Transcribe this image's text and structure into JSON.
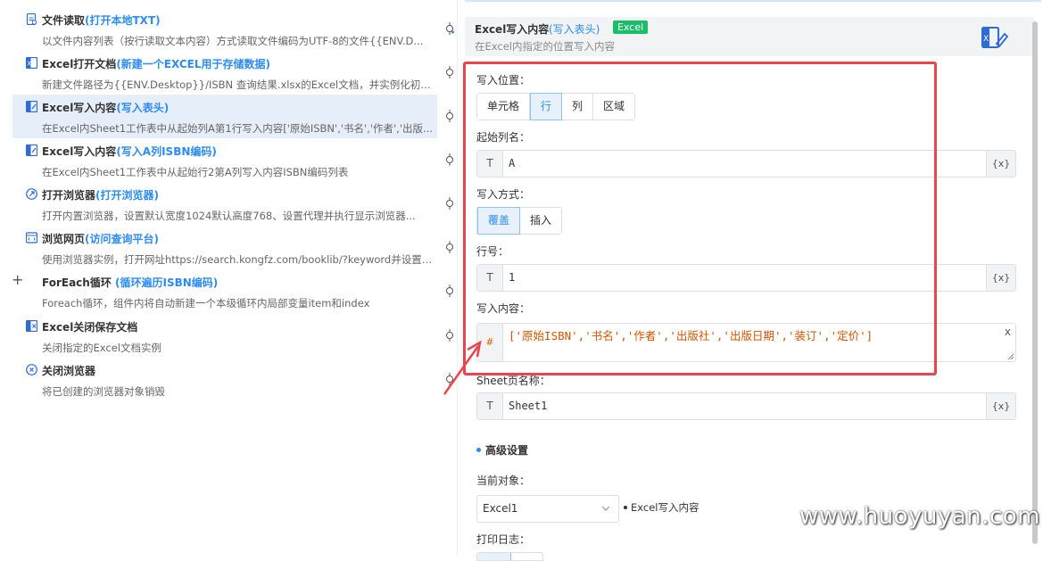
{
  "steps": [
    {
      "title": "文件读取",
      "link": "(打开本地TXT)",
      "desc": "以文件内容列表（按行读取文本内容）方式读取文件编码为UTF-8的文件{{ENV.D...",
      "icon": "file-read-icon"
    },
    {
      "title": "Excel打开文档",
      "link": "(新建一个EXCEL用于存储数据)",
      "desc": "新建文件路径为{{ENV.Desktop}}/ISBN 查询结果.xlsx的Excel文档，并实例化初始...",
      "icon": "excel-open-icon"
    },
    {
      "title": "Excel写入内容",
      "link": "(写入表头)",
      "desc": "在Excel内Sheet1工作表中从起始列A第1行写入内容['原始ISBN','书名','作者','出版...",
      "icon": "excel-write-icon"
    },
    {
      "title": "Excel写入内容",
      "link": "(写入A列ISBN编码)",
      "desc": "在Excel内Sheet1工作表中从起始行2第A列写入内容ISBN编码列表",
      "icon": "excel-write-icon"
    },
    {
      "title": "打开浏览器",
      "link": "(打开浏览器)",
      "desc": "打开内置浏览器，设置默认宽度1024默认高度768、设置代理并执行显示浏览器...",
      "icon": "browser-open-icon"
    },
    {
      "title": "浏览网页",
      "link": "(访问查询平台)",
      "desc": "使用浏览器实例，打开网址https://search.kongfz.com/booklib/?keyword并设置Us...",
      "icon": "browse-web-icon"
    },
    {
      "title": "ForEach循环",
      "link": " (循环遍历ISBN编码)",
      "desc": "Foreach循环，组件内将自动新建一个本级循环内局部变量item和index",
      "icon": "loop-icon"
    },
    {
      "title": "Excel关闭保存文档",
      "link": "",
      "desc": "关闭指定的Excel文档实例",
      "icon": "excel-close-icon"
    },
    {
      "title": "关闭浏览器",
      "link": "",
      "desc": "将已创建的浏览器对象销毁",
      "icon": "browser-close-icon"
    }
  ],
  "header": {
    "title": "Excel写入内容",
    "subtitle": "(写入表头)",
    "badge": "Excel",
    "desc": "在Excel内指定的位置写入内容"
  },
  "form": {
    "write_position_label": "写入位置：",
    "write_position_options": [
      "单元格",
      "行",
      "列",
      "区域"
    ],
    "write_position_selected": "行",
    "start_col_label": "起始列名：",
    "start_col_value": "A",
    "write_mode_label": "写入方式：",
    "write_mode_options": [
      "覆盖",
      "插入"
    ],
    "write_mode_selected": "覆盖",
    "row_label": "行号：",
    "row_value": "1",
    "content_label": "写入内容：",
    "content_value": "['原始ISBN','书名','作者','出版社','出版日期','装订','定价']",
    "sheet_label": "Sheet页名称：",
    "sheet_value": "Sheet1",
    "text_prefix": "T",
    "expr_prefix": "#",
    "var_suffix": "{x}",
    "clear": "x"
  },
  "advanced": {
    "title": "高级设置",
    "current_object_label": "当前对象：",
    "current_object_value": "Excel1",
    "current_object_hint": "Excel写入内容",
    "print_log_label": "打印日志："
  },
  "watermark": "www.huoyuyan.com",
  "colors": {
    "accent": "#2d8cf0",
    "badge": "#19be6b",
    "highlight_box": "#e8454e",
    "expression": "#d35400"
  }
}
